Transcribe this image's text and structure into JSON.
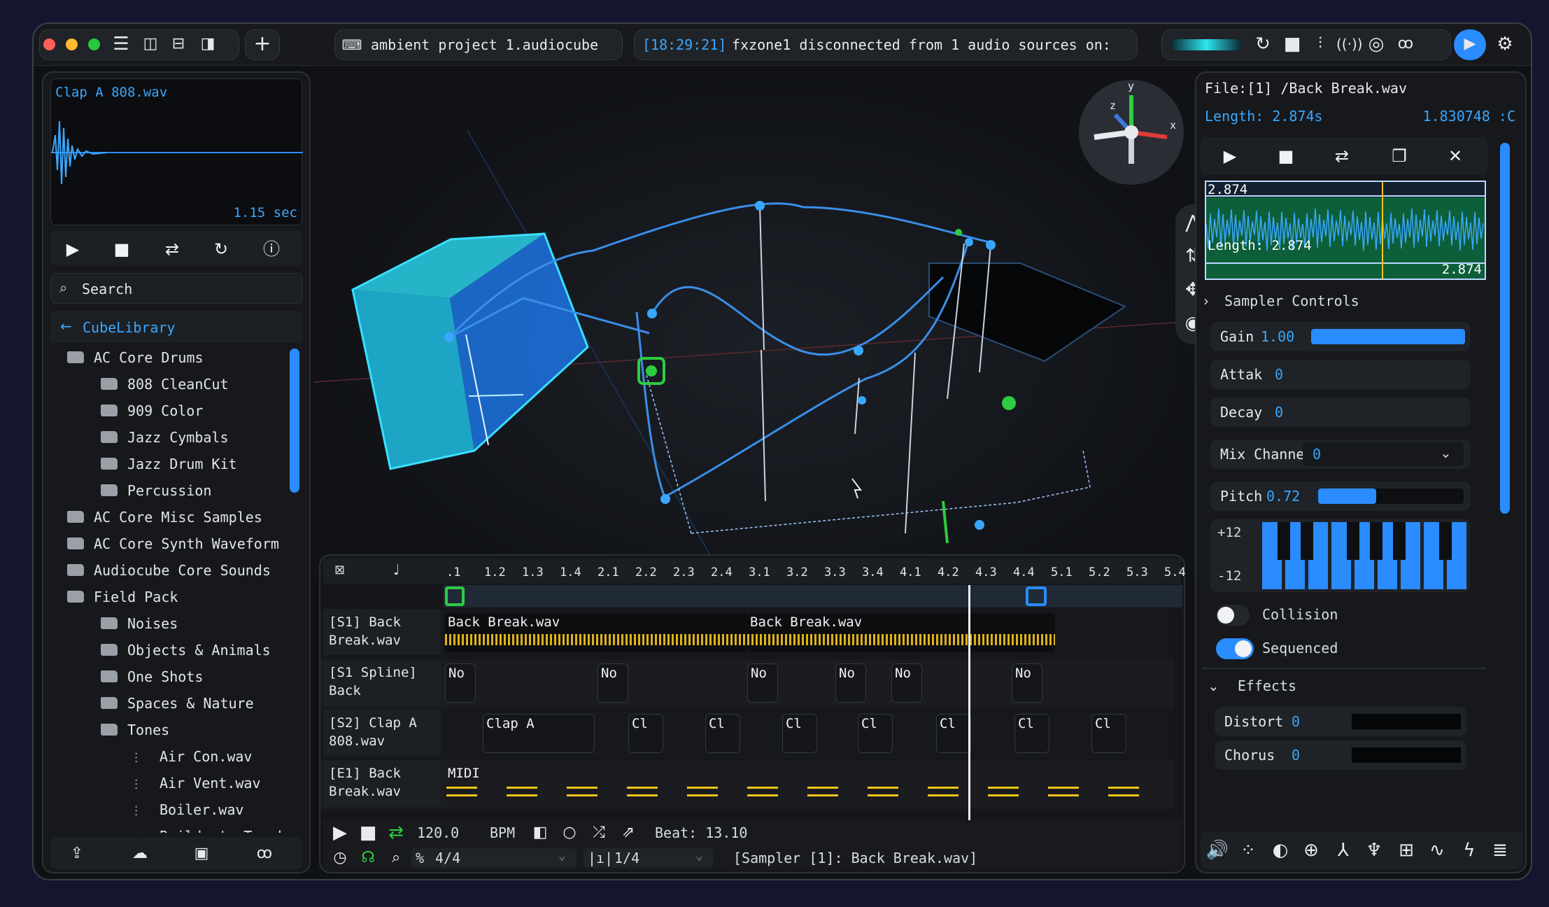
{
  "topbar": {
    "project_name": "ambient project 1.audiocube",
    "log_time": "[18:29:21]",
    "log_message": "fxzone1 disconnected from 1 audio sources on:",
    "icons": [
      "menu-icon",
      "sidebar-left-icon",
      "panel-bottom-icon",
      "sidebar-right-icon",
      "plus-icon",
      "terminal-icon",
      "loop-arrow-icon",
      "stop-icon",
      "mixer-icon",
      "broadcast-icon",
      "target-icon",
      "voicemail-icon",
      "camera-icon",
      "gear-icon"
    ]
  },
  "left_panel": {
    "preview_file": "Clap A 808.wav",
    "preview_duration": "1.15 sec",
    "search_placeholder": "Search",
    "library_title": "CubeLibrary",
    "tree": [
      {
        "label": "AC Core Drums",
        "type": "folder-open",
        "level": 0
      },
      {
        "label": "808 CleanCut",
        "type": "folder",
        "level": 1
      },
      {
        "label": "909 Color",
        "type": "folder",
        "level": 1
      },
      {
        "label": "Jazz Cymbals",
        "type": "folder",
        "level": 1
      },
      {
        "label": "Jazz Drum Kit",
        "type": "folder",
        "level": 1
      },
      {
        "label": "Percussion",
        "type": "folder",
        "level": 1
      },
      {
        "label": "AC Core Misc Samples",
        "type": "folder",
        "level": 0
      },
      {
        "label": "AC Core Synth Waveform",
        "type": "folder",
        "level": 0
      },
      {
        "label": "Audiocube Core Sounds",
        "type": "folder",
        "level": 0
      },
      {
        "label": "Field Pack",
        "type": "folder-open",
        "level": 0
      },
      {
        "label": "Noises",
        "type": "folder",
        "level": 1
      },
      {
        "label": "Objects & Animals",
        "type": "folder",
        "level": 1
      },
      {
        "label": "One Shots",
        "type": "folder",
        "level": 1
      },
      {
        "label": "Spaces & Nature",
        "type": "folder",
        "level": 1
      },
      {
        "label": "Tones",
        "type": "folder-open",
        "level": 1
      },
      {
        "label": "Air Con.wav",
        "type": "file",
        "level": 2
      },
      {
        "label": "Air Vent.wav",
        "type": "file",
        "level": 2
      },
      {
        "label": "Boiler.wav",
        "type": "file",
        "level": 2
      },
      {
        "label": "Builder's Truck",
        "type": "file",
        "level": 2
      }
    ]
  },
  "viewport": {
    "gizmo_x": "x",
    "gizmo_y": "y",
    "gizmo_z": "z"
  },
  "sequencer": {
    "ruler": [
      ".1",
      "1.2",
      "1.3",
      "1.4",
      "2.1",
      "2.2",
      "2.3",
      "2.4",
      "3.1",
      "3.2",
      "3.3",
      "3.4",
      "4.1",
      "4.2",
      "4.3",
      "4.4",
      "5.1",
      "5.2",
      "5.3",
      "5.4"
    ],
    "tracks": [
      {
        "label": "[S1] Back Break.wav",
        "clips": [
          "Back Break.wav",
          "Back Break.wav"
        ]
      },
      {
        "label": "[S1 Spline] Back",
        "clips": [
          "No",
          "No",
          "No",
          "No",
          "No",
          "No"
        ]
      },
      {
        "label": "[S2] Clap A 808.wav",
        "clips": [
          "Clap A",
          "Cl",
          "Cl",
          "Cl",
          "Cl",
          "Cl",
          "Cl",
          "Cl"
        ]
      },
      {
        "label": "[E1] Back Break.wav",
        "clips": [
          "MIDI"
        ]
      }
    ],
    "transport": {
      "tempo": "120.0",
      "tempo_unit": "BPM",
      "beat": "Beat: 13.10",
      "time_sig": "4/4",
      "quantize": "1/4",
      "status": "[Sampler [1]: Back Break.wav]"
    }
  },
  "right_panel": {
    "file_label": "File:[1] /Back Break.wav",
    "length_label": "Length: 2.874s",
    "length_right": "1.830748 :C",
    "wave_top": "2.874",
    "wave_length": "Length: 2.874",
    "wave_end": "2.874",
    "sampler_title": "Sampler Controls",
    "gain_label": "Gain",
    "gain_value": "1.00",
    "gain_level": 1.0,
    "attack_label": "Attak",
    "attack_value": "0",
    "decay_label": "Decay",
    "decay_value": "0",
    "mix_label": "Mix Channel",
    "mix_value": "0",
    "pitch_label": "Pitch",
    "pitch_value": "0.72",
    "pitch_level": 0.4,
    "range_plus": "+12",
    "range_minus": "-12",
    "collision_label": "Collision",
    "collision_on": false,
    "sequenced_label": "Sequenced",
    "sequenced_on": true,
    "effects_title": "Effects",
    "distort_label": "Distort",
    "distort_value": "0",
    "chorus_label": "Chorus",
    "chorus_value": "0"
  },
  "colors": {
    "accent": "#2a8cff",
    "clip_wave": "#f5c518",
    "green": "#2ecc40",
    "window_bg": "#0f1114"
  }
}
